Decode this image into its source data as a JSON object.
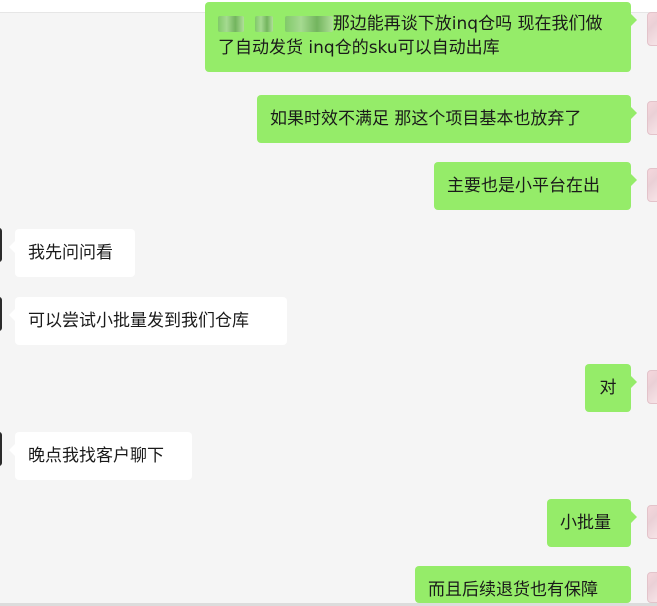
{
  "colors": {
    "background": "#f5f5f5",
    "outgoing_bubble": "#95ec69",
    "incoming_bubble": "#ffffff",
    "text": "#1a1a1a"
  },
  "messages": [
    {
      "side": "right",
      "line1": "那边能再谈下放inq仓吗 现在我们做",
      "line2": "了自动发货 inq仓的sku可以自动出库"
    },
    {
      "side": "right",
      "text": "如果时效不满足 那这个项目基本也放弃了"
    },
    {
      "side": "right",
      "text": "主要也是小平台在出"
    },
    {
      "side": "left",
      "text": "我先问问看"
    },
    {
      "side": "left",
      "text": "可以尝试小批量发到我们仓库"
    },
    {
      "side": "right",
      "text": "对"
    },
    {
      "side": "left",
      "text": "晚点我找客户聊下"
    },
    {
      "side": "right",
      "text": "小批量"
    },
    {
      "side": "right",
      "text": "而且后续退货也有保障"
    }
  ]
}
